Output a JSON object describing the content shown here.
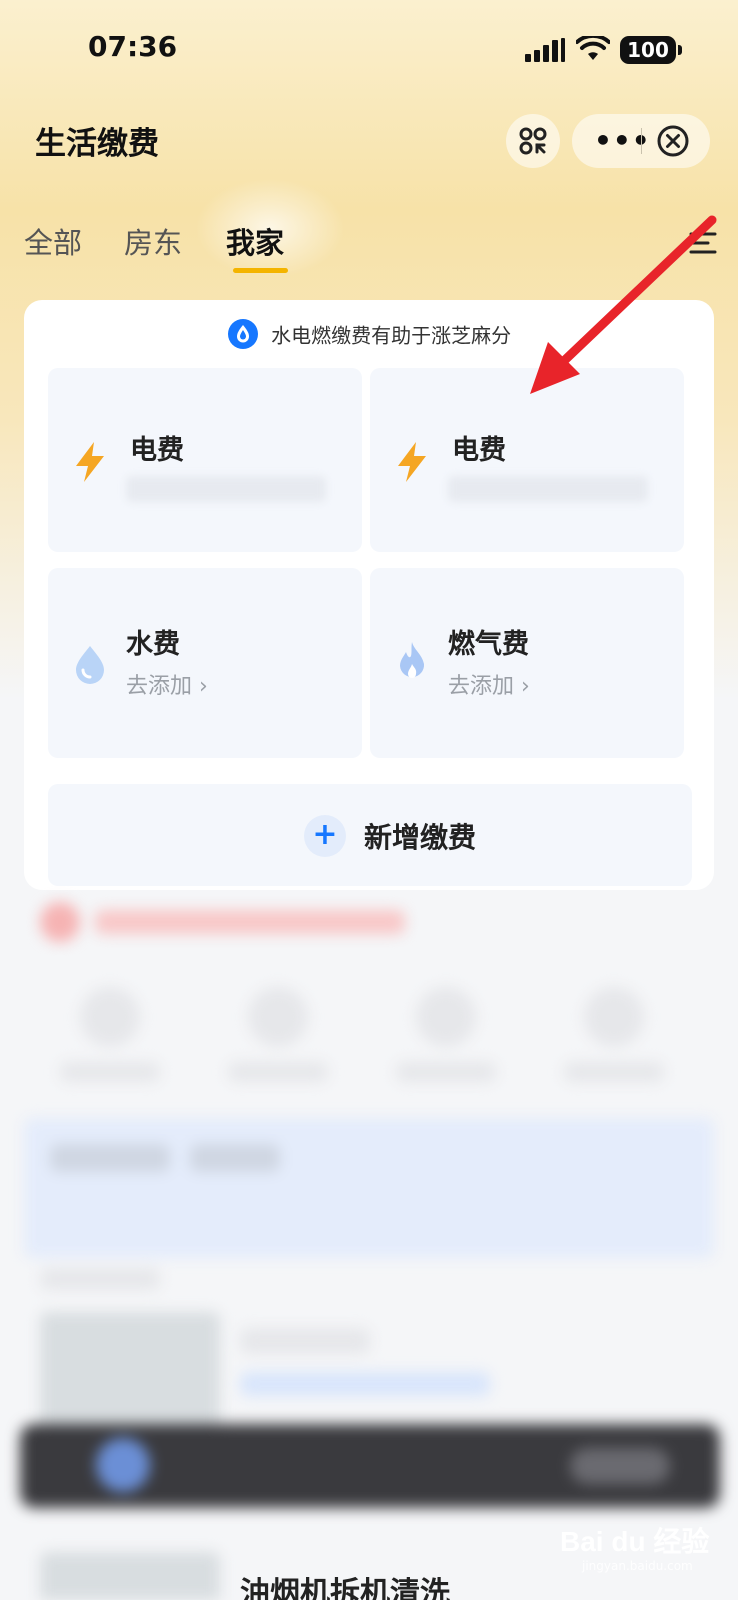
{
  "status_bar": {
    "time": "07:36",
    "battery": "100"
  },
  "nav": {
    "title": "生活缴费"
  },
  "tabs": [
    {
      "label": "全部",
      "active": false
    },
    {
      "label": "房东",
      "active": false
    },
    {
      "label": "我家",
      "active": true
    }
  ],
  "card": {
    "sesame_text": "水电燃缴费有助于涨芝麻分",
    "tiles": [
      {
        "title": "电费",
        "icon": "lightning-icon",
        "subtitle": ""
      },
      {
        "title": "电费",
        "icon": "lightning-icon",
        "subtitle": ""
      },
      {
        "title": "水费",
        "icon": "water-drop-icon",
        "subtitle": "去添加 ›"
      },
      {
        "title": "燃气费",
        "icon": "flame-icon",
        "subtitle": "去添加 ›"
      }
    ],
    "add_label": "新增缴费"
  },
  "bottom": {
    "partial_title": "油烟机拆机清洗"
  },
  "watermark": {
    "text": "Bai du 经验",
    "sub": "jingyan.baidu.com"
  },
  "colors": {
    "accent_tab": "#f4b400",
    "lightning": "#f5a623",
    "water": "#b9d4f7",
    "flame": "#a9c7f5",
    "arrow": "#e8242a",
    "add_plus": "#1677ff"
  }
}
